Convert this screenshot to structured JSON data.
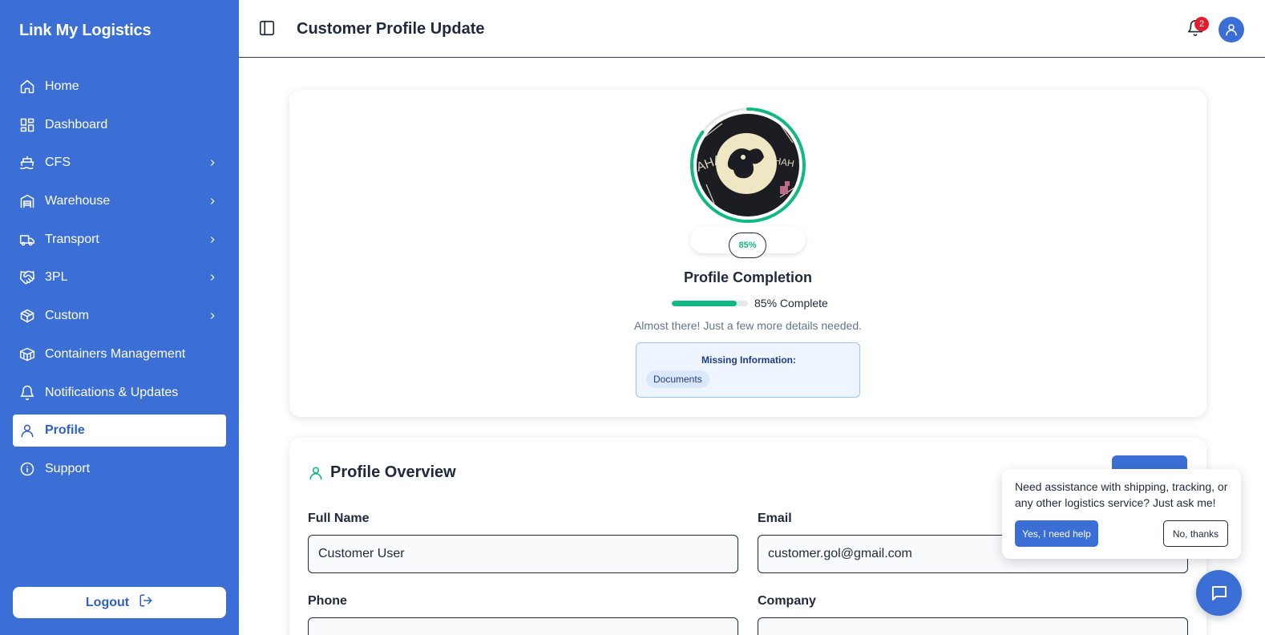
{
  "app": {
    "brand": "Link My Logistics"
  },
  "sidebar": {
    "items": [
      {
        "label": "Home",
        "icon": "home-icon",
        "has_submenu": false
      },
      {
        "label": "Dashboard",
        "icon": "dashboard-icon",
        "has_submenu": false
      },
      {
        "label": "CFS",
        "icon": "ship-icon",
        "has_submenu": true
      },
      {
        "label": "Warehouse",
        "icon": "warehouse-icon",
        "has_submenu": true
      },
      {
        "label": "Transport",
        "icon": "truck-icon",
        "has_submenu": true
      },
      {
        "label": "3PL",
        "icon": "handshake-icon",
        "has_submenu": true
      },
      {
        "label": "Custom",
        "icon": "package-icon",
        "has_submenu": true
      },
      {
        "label": "Containers Management",
        "icon": "container-icon",
        "has_submenu": false
      },
      {
        "label": "Notifications & Updates",
        "icon": "bell-icon",
        "has_submenu": false
      },
      {
        "label": "Profile",
        "icon": "user-icon",
        "has_submenu": false,
        "active": true
      },
      {
        "label": "Support",
        "icon": "info-icon",
        "has_submenu": false
      }
    ],
    "logout_label": "Logout"
  },
  "header": {
    "title": "Customer Profile Update",
    "notification_count": "2"
  },
  "completion": {
    "percent_label": "85%",
    "percent_value": 0.85,
    "title": "Profile Completion",
    "progress_text": "85% Complete",
    "subtitle": "Almost there! Just a few more details needed.",
    "missing_title": "Missing Information:",
    "missing_items": [
      "Documents"
    ]
  },
  "overview": {
    "title": "Profile Overview",
    "fields": {
      "full_name": {
        "label": "Full Name",
        "value": "Customer User"
      },
      "email": {
        "label": "Email",
        "value": "customer.gol@gmail.com"
      },
      "phone": {
        "label": "Phone",
        "value": ""
      },
      "company": {
        "label": "Company",
        "value": ""
      }
    }
  },
  "chat": {
    "message": "Need assistance with shipping, tracking, or any other logistics service? Just ask me!",
    "yes_label": "Yes, I need help",
    "no_label": "No, thanks"
  },
  "colors": {
    "sidebar_bg": "#3b6fd6",
    "accent_green": "#10b981",
    "badge_red": "#e11d2e",
    "text_dark": "#1e293b"
  }
}
